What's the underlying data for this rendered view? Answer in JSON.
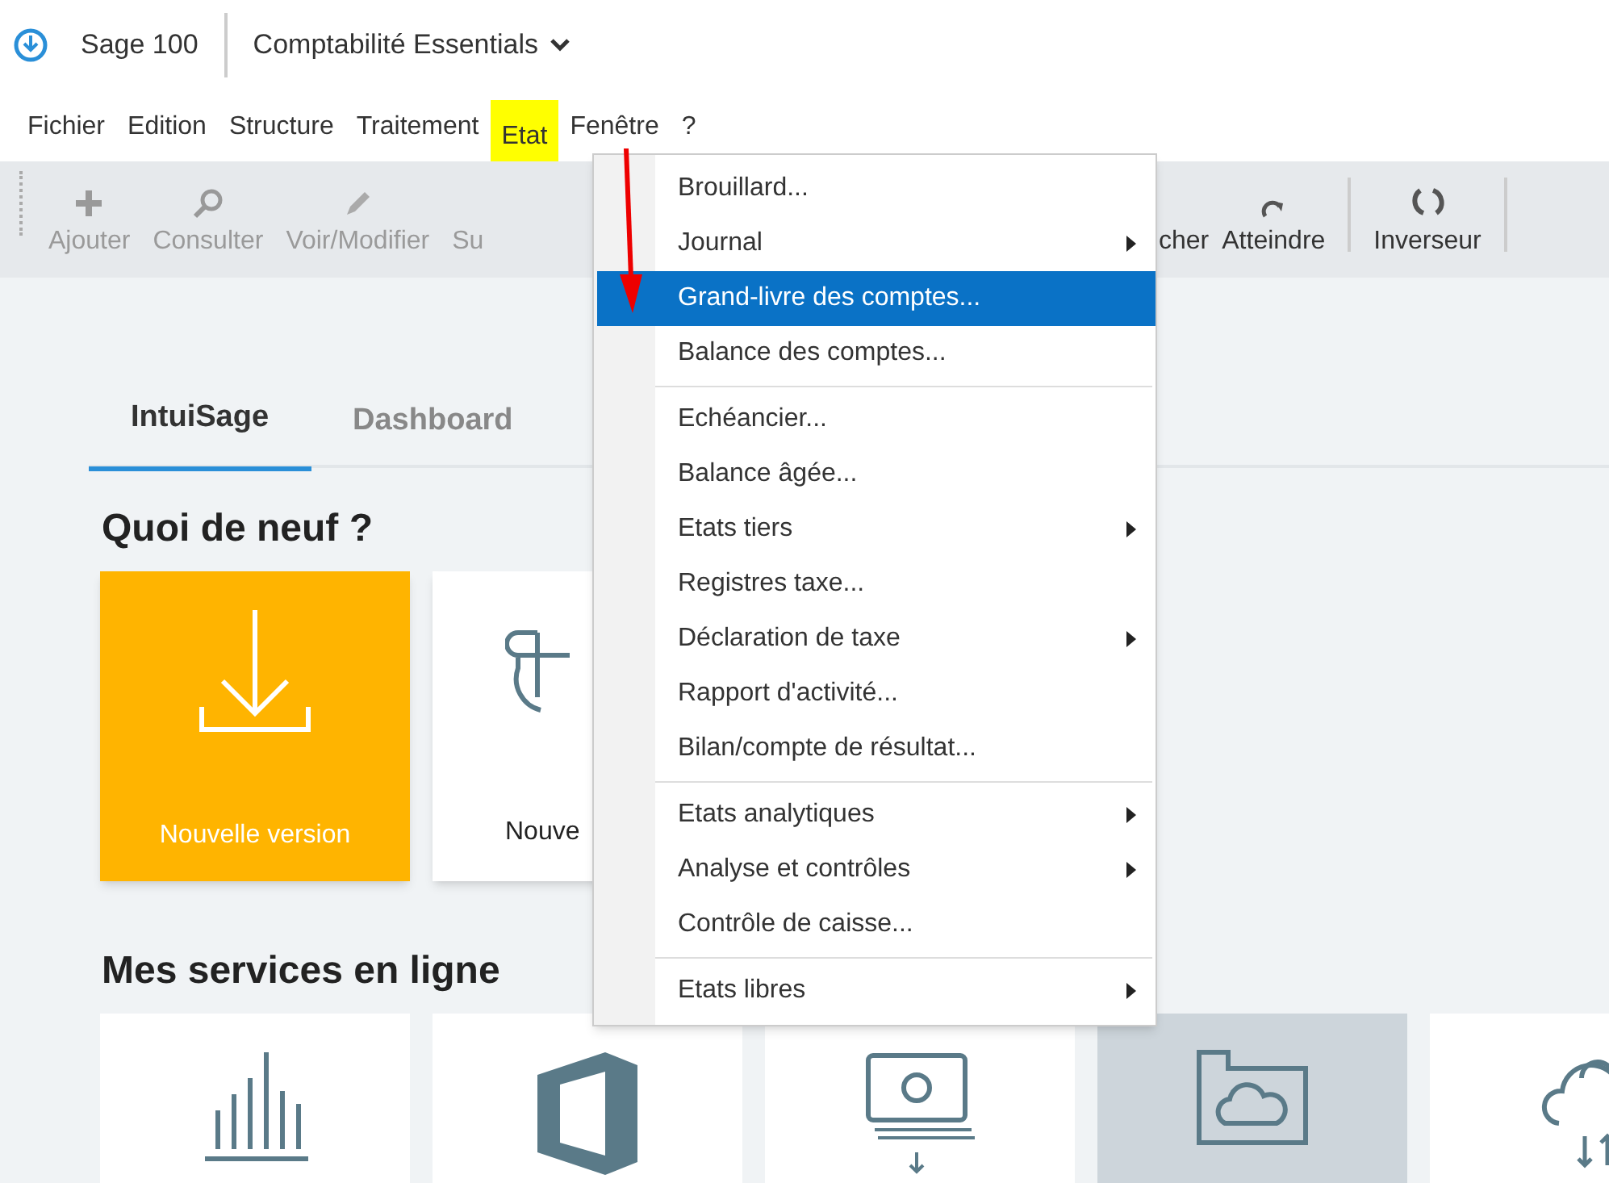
{
  "app_bar": {
    "brand": "Sage 100",
    "product": "Comptabilité Essentials"
  },
  "menu_bar": [
    {
      "label": "Fichier",
      "selected": false
    },
    {
      "label": "Edition",
      "selected": false
    },
    {
      "label": "Structure",
      "selected": false
    },
    {
      "label": "Traitement",
      "selected": false
    },
    {
      "label": "Etat",
      "selected": true
    },
    {
      "label": "Fenêtre",
      "selected": false
    },
    {
      "label": "?",
      "selected": false
    }
  ],
  "toolbar": {
    "left": [
      {
        "label": "Ajouter",
        "kind": "plus"
      },
      {
        "label": "Consulter",
        "kind": "search"
      },
      {
        "label": "Voir/Modifier",
        "kind": "pencil"
      },
      {
        "label": "Su",
        "kind": "none"
      }
    ],
    "right": [
      {
        "label": "cher",
        "kind": "none"
      },
      {
        "label": "Atteindre",
        "kind": "redo"
      },
      {
        "label": "Inverseur",
        "kind": "refresh"
      }
    ]
  },
  "tabs": [
    {
      "label": "IntuiSage",
      "selected": true
    },
    {
      "label": "Dashboard",
      "selected": false
    }
  ],
  "whats_new": {
    "title": "Quoi de neuf ?",
    "cards": [
      {
        "label": "Nouvelle version",
        "kind": "download"
      },
      {
        "label": "Nouve",
        "kind": "feature"
      }
    ]
  },
  "online_services": {
    "title": "Mes services en ligne",
    "cards": [
      {
        "kind": "chart",
        "highlighted": false
      },
      {
        "kind": "office",
        "highlighted": false
      },
      {
        "kind": "money",
        "highlighted": false
      },
      {
        "kind": "folder",
        "highlighted": true
      },
      {
        "kind": "cloud",
        "highlighted": false
      }
    ]
  },
  "dropdown_menu": {
    "groups": [
      [
        {
          "label": "Brouillard...",
          "submenu": false,
          "selected": false
        },
        {
          "label": "Journal",
          "submenu": true,
          "selected": false
        },
        {
          "label": "Grand-livre des comptes...",
          "submenu": false,
          "selected": true
        },
        {
          "label": "Balance des comptes...",
          "submenu": false,
          "selected": false
        }
      ],
      [
        {
          "label": "Echéancier...",
          "submenu": false,
          "selected": false
        },
        {
          "label": "Balance âgée...",
          "submenu": false,
          "selected": false
        },
        {
          "label": "Etats tiers",
          "submenu": true,
          "selected": false
        },
        {
          "label": "Registres taxe...",
          "submenu": false,
          "selected": false
        },
        {
          "label": "Déclaration de taxe",
          "submenu": true,
          "selected": false
        },
        {
          "label": "Rapport d'activité...",
          "submenu": false,
          "selected": false
        },
        {
          "label": "Bilan/compte de résultat...",
          "submenu": false,
          "selected": false
        }
      ],
      [
        {
          "label": "Etats analytiques",
          "submenu": true,
          "selected": false
        },
        {
          "label": "Analyse et contrôles",
          "submenu": true,
          "selected": false
        },
        {
          "label": "Contrôle de caisse...",
          "submenu": false,
          "selected": false
        }
      ],
      [
        {
          "label": "Etats libres",
          "submenu": true,
          "selected": false
        }
      ]
    ]
  }
}
